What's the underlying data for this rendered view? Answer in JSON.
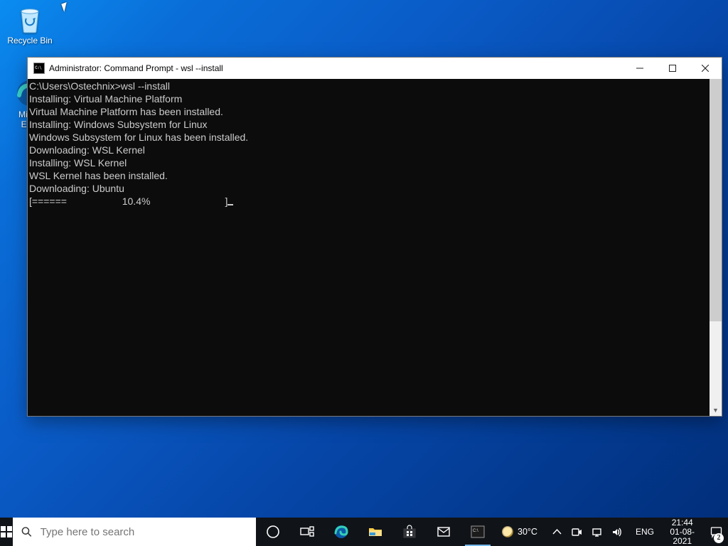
{
  "desktop": {
    "icons": [
      {
        "name": "recycle-bin",
        "label": "Recycle Bin"
      },
      {
        "name": "microsoft-edge",
        "label": "Micr..."
      },
      {
        "name": "edge-doc",
        "label": "Ed..."
      }
    ]
  },
  "window": {
    "title": "Administrator: Command Prompt - wsl  --install",
    "prompt_path": "C:\\Users\\Ostechnix>",
    "prompt_cmd": "wsl --install",
    "lines": [
      "Installing: Virtual Machine Platform",
      "Virtual Machine Platform has been installed.",
      "Installing: Windows Subsystem for Linux",
      "Windows Subsystem for Linux has been installed.",
      "Downloading: WSL Kernel",
      "Installing: WSL Kernel",
      "WSL Kernel has been installed.",
      "Downloading: Ubuntu"
    ],
    "progress_line": "[======                    10.4%                           ]",
    "progress_percent": 10.4
  },
  "taskbar": {
    "search_placeholder": "Type here to search",
    "apps": [
      {
        "name": "cortana"
      },
      {
        "name": "task-view"
      },
      {
        "name": "edge"
      },
      {
        "name": "file-explorer"
      },
      {
        "name": "microsoft-store"
      },
      {
        "name": "mail"
      },
      {
        "name": "command-prompt",
        "active": true
      }
    ],
    "weather_temp": "30°C",
    "tray": {
      "chevron": "chevron-up",
      "meet_now": "meet-now",
      "network": "network",
      "volume": "volume",
      "language": "ENG"
    },
    "time": "21:44",
    "date": "01-08-2021",
    "notifications_count": "2"
  },
  "colors": {
    "taskbar_bg": "#101318",
    "terminal_bg": "#0c0c0c",
    "terminal_fg": "#cccccc",
    "accent": "#76b9ed"
  }
}
